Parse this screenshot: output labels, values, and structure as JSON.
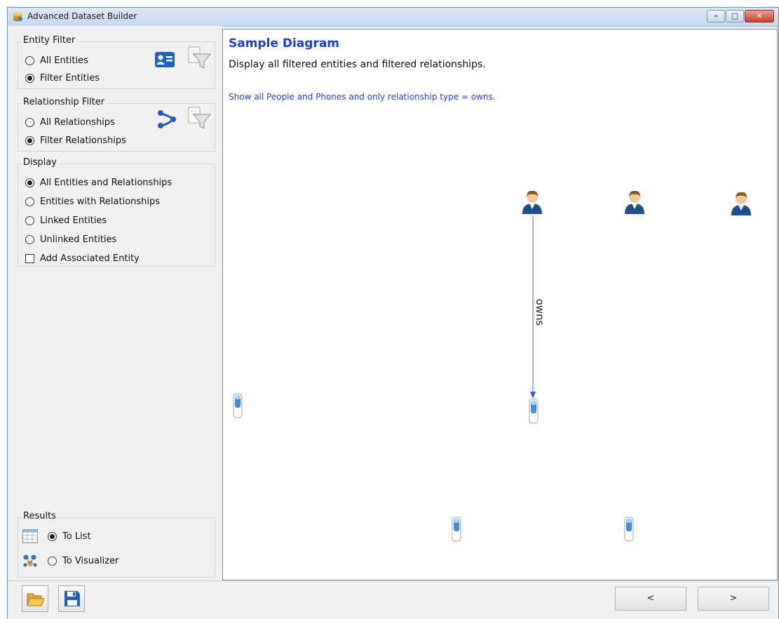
{
  "window": {
    "title": "Advanced Dataset Builder",
    "controls": {
      "minimize": "–",
      "maximize": "□",
      "close": "✕"
    }
  },
  "entity_filter": {
    "title": "Entity Filter",
    "options": [
      {
        "label": "All Entities",
        "checked": false
      },
      {
        "label": "Filter Entities",
        "checked": true
      }
    ],
    "icons": [
      "contact-card-icon",
      "filter-funnel-icon"
    ]
  },
  "relationship_filter": {
    "title": "Relationship Filter",
    "options": [
      {
        "label": "All Relationships",
        "checked": false
      },
      {
        "label": "Filter Relationships",
        "checked": true
      }
    ],
    "icons": [
      "share-nodes-icon",
      "filter-funnel-icon"
    ]
  },
  "display": {
    "title": "Display",
    "options": [
      {
        "label": "All Entities and Relationships",
        "checked": true
      },
      {
        "label": "Entities with Relationships",
        "checked": false
      },
      {
        "label": "Linked Entities",
        "checked": false
      },
      {
        "label": "Unlinked Entities",
        "checked": false
      }
    ],
    "checkbox": {
      "label": "Add Associated Entity",
      "checked": false
    }
  },
  "results": {
    "title": "Results",
    "options": [
      {
        "label": "To List",
        "checked": true,
        "icon": "grid-list-icon"
      },
      {
        "label": "To Visualizer",
        "checked": false,
        "icon": "visualizer-network-icon"
      }
    ]
  },
  "diagram": {
    "title": "Sample Diagram",
    "subtitle": "Display all filtered entities and filtered relationships.",
    "note": "Show all People and Phones and only relationship type = owns.",
    "edge_label": "owns",
    "colors": {
      "title": "#1a3fd6",
      "note": "#2b3ff0",
      "edge": "#7a9be0"
    }
  },
  "bottom": {
    "prev_label": "<",
    "next_label": ">",
    "icons": [
      "open-folder-icon",
      "save-disk-icon"
    ]
  }
}
